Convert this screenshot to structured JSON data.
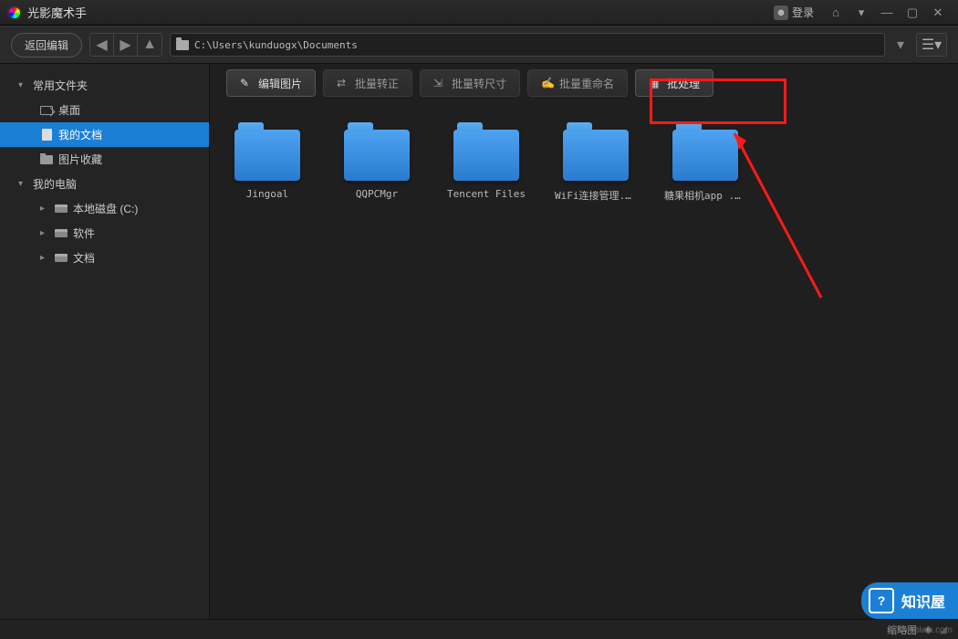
{
  "app": {
    "title": "光影魔术手"
  },
  "titlebar": {
    "login": "登录"
  },
  "nav": {
    "back": "返回编辑",
    "path": "C:\\Users\\kunduogx\\Documents"
  },
  "sidebar": {
    "fav_folders": "常用文件夹",
    "desktop": "桌面",
    "my_docs": "我的文档",
    "pic_fav": "图片收藏",
    "my_pc": "我的电脑",
    "drive_c": "本地磁盘 (C:)",
    "software": "软件",
    "docs": "文档"
  },
  "toolbar": {
    "edit": "编辑图片",
    "convert": "批量转正",
    "resize": "批量转尺寸",
    "rename": "批量重命名",
    "batch": "批处理"
  },
  "files": [
    {
      "name": "Jingoal"
    },
    {
      "name": "QQPCMgr"
    },
    {
      "name": "Tencent Files"
    },
    {
      "name": "WiFi连接管理..."
    },
    {
      "name": "糖果相机app ..."
    }
  ],
  "status": {
    "thumb": "缩略图"
  },
  "badge": {
    "text": "知识屋"
  },
  "watermark": "zhishiwu.com"
}
